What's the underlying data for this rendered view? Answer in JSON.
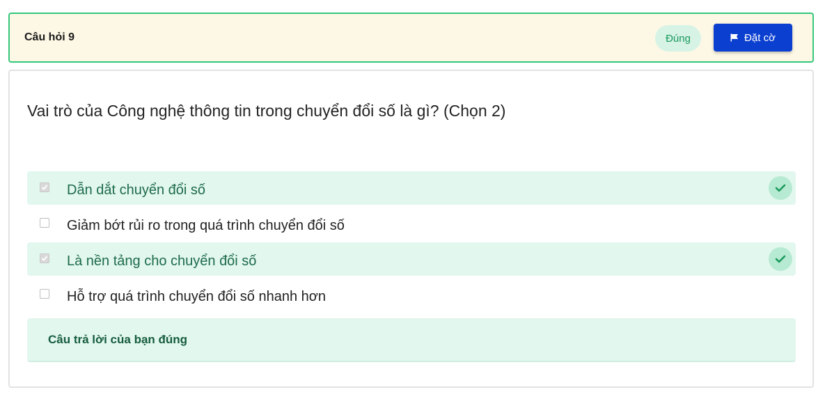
{
  "header": {
    "question_label": "Câu hỏi 9",
    "status": "Đúng",
    "flag_label": "Đặt cờ"
  },
  "question": {
    "text": "Vai trò của Công nghệ thông tin trong chuyển đổi số là gì? (Chọn 2)"
  },
  "options": [
    {
      "label": "Dẫn dắt chuyển đổi số",
      "checked": true,
      "correct": true
    },
    {
      "label": "Giảm bớt rủi ro trong quá trình chuyển đổi số",
      "checked": false,
      "correct": false
    },
    {
      "label": "Là nền tảng cho chuyển đổi số",
      "checked": true,
      "correct": true
    },
    {
      "label": "Hỗ trợ quá trình chuyển đổi số nhanh hơn",
      "checked": false,
      "correct": false
    }
  ],
  "feedback": {
    "text": "Câu trả lời của bạn đúng"
  },
  "colors": {
    "accent_green": "#34c77b",
    "header_bg": "#fdf8e6",
    "correct_bg": "#e2f7ee",
    "button_blue": "#0b3fd0"
  },
  "icons": {
    "flag": "flag-icon",
    "check": "check-icon"
  }
}
